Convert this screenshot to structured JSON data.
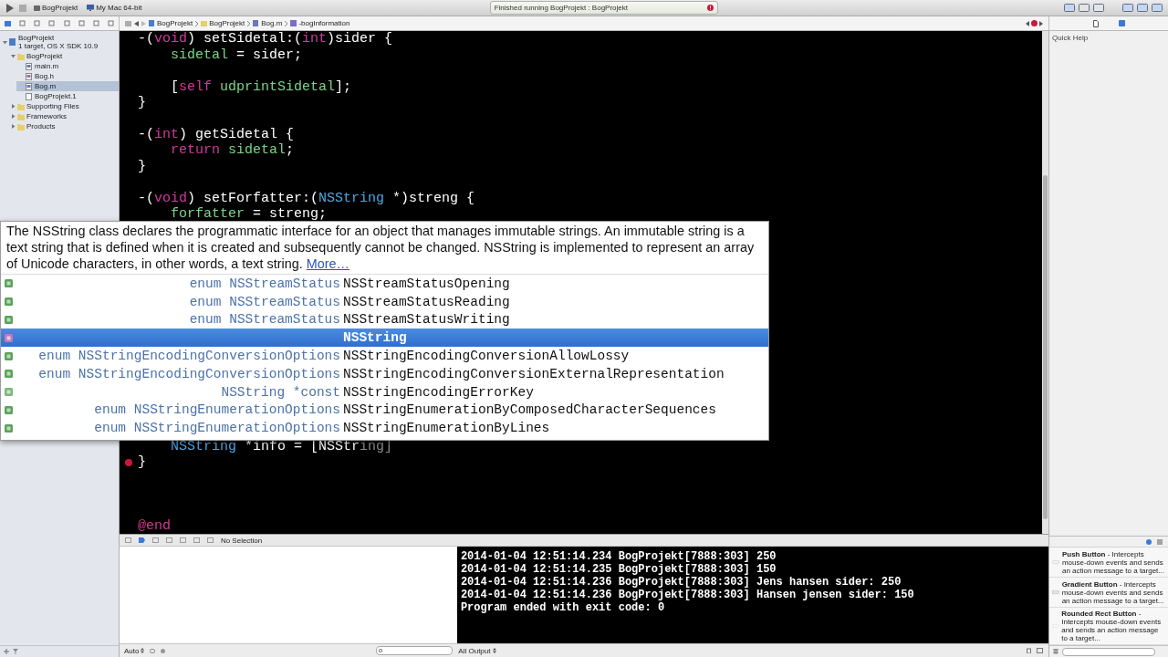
{
  "toolbar": {
    "scheme": "BogProjekt",
    "destination": "My Mac 64-bit",
    "status": "Finished running BogProjekt : BogProjekt"
  },
  "jump_bar": [
    "BogProjekt",
    "BogProjekt",
    "Bog.m",
    "-bogInformation"
  ],
  "navigator": {
    "tree": [
      {
        "label": "BogProjekt",
        "subtitle": "1 target, OS X SDK 10.9",
        "kind": "project",
        "expanded": true,
        "selected": false,
        "children": [
          {
            "label": "BogProjekt",
            "kind": "folder",
            "expanded": true,
            "selected": false,
            "children": [
              {
                "label": "main.m",
                "kind": "source",
                "selected": false
              },
              {
                "label": "Bog.h",
                "kind": "header",
                "selected": false
              },
              {
                "label": "Bog.m",
                "kind": "source",
                "selected": true
              },
              {
                "label": "BogProjekt.1",
                "kind": "doc",
                "selected": false
              }
            ]
          },
          {
            "label": "Supporting Files",
            "kind": "folder",
            "expanded": false,
            "selected": false
          },
          {
            "label": "Frameworks",
            "kind": "folder",
            "expanded": false,
            "selected": false
          },
          {
            "label": "Products",
            "kind": "folder",
            "expanded": false,
            "selected": false
          }
        ]
      }
    ]
  },
  "editor": {
    "top_lines": [
      {
        "kind": "code",
        "indented": false,
        "tokens": [
          {
            "text": "-(",
            "kind": "plain"
          },
          {
            "text": "void",
            "kind": "keyword"
          },
          {
            "text": ") setSidetal:(",
            "kind": "plain"
          },
          {
            "text": "int",
            "kind": "keyword"
          },
          {
            "text": ")sider {",
            "kind": "plain"
          }
        ]
      },
      {
        "kind": "code",
        "indented": true,
        "tokens": [
          {
            "text": "sidetal",
            "kind": "ivar"
          },
          {
            "text": " = sider;",
            "kind": "plain"
          }
        ]
      },
      {
        "kind": "blank"
      },
      {
        "kind": "code",
        "indented": true,
        "tokens": [
          {
            "text": "[",
            "kind": "plain"
          },
          {
            "text": "self ",
            "kind": "keyword"
          },
          {
            "text": "udprintSidetal",
            "kind": "ivar"
          },
          {
            "text": "];",
            "kind": "plain"
          }
        ]
      },
      {
        "kind": "code",
        "indented": false,
        "tokens": [
          {
            "text": "}",
            "kind": "plain"
          }
        ]
      },
      {
        "kind": "blank"
      },
      {
        "kind": "code",
        "indented": false,
        "tokens": [
          {
            "text": "-(",
            "kind": "plain"
          },
          {
            "text": "int",
            "kind": "keyword"
          },
          {
            "text": ") getSidetal {",
            "kind": "plain"
          }
        ]
      },
      {
        "kind": "code",
        "indented": true,
        "tokens": [
          {
            "text": "return ",
            "kind": "keyword"
          },
          {
            "text": "sidetal",
            "kind": "ivar"
          },
          {
            "text": ";",
            "kind": "plain"
          }
        ]
      },
      {
        "kind": "code",
        "indented": false,
        "tokens": [
          {
            "text": "}",
            "kind": "plain"
          }
        ]
      },
      {
        "kind": "blank"
      },
      {
        "kind": "code",
        "indented": false,
        "tokens": [
          {
            "text": "-(",
            "kind": "plain"
          },
          {
            "text": "void",
            "kind": "keyword"
          },
          {
            "text": ") setForfatter:(",
            "kind": "plain"
          },
          {
            "text": "NSString",
            "kind": "type"
          },
          {
            "text": " *)streng {",
            "kind": "plain"
          }
        ]
      },
      {
        "kind": "code",
        "indented": true,
        "tokens": [
          {
            "text": "forfatter",
            "kind": "ivar"
          },
          {
            "text": " = streng;",
            "kind": "plain"
          }
        ]
      }
    ],
    "bottom_lines": [
      {
        "kind": "code",
        "indented": true,
        "tokens": [
          {
            "text": "NSString",
            "kind": "type"
          },
          {
            "text": " *info = [NSStr",
            "kind": "plain"
          },
          {
            "text": "ing]",
            "kind": "placeholder"
          }
        ]
      },
      {
        "kind": "code",
        "indented": false,
        "issue": true,
        "tokens": [
          {
            "text": "}",
            "kind": "plain"
          }
        ]
      },
      {
        "kind": "blank"
      },
      {
        "kind": "blank"
      },
      {
        "kind": "blank"
      },
      {
        "kind": "code",
        "indented": false,
        "tokens": [
          {
            "text": "@end",
            "kind": "directive"
          }
        ]
      }
    ]
  },
  "completion": {
    "description": "The NSString class declares the programmatic interface for an object that manages immutable strings. An immutable string is a text string that is defined when it is created and subsequently cannot be changed. NSString is implemented to represent an array of Unicode characters, in other words, a text string.",
    "more_link": "More…",
    "rows": [
      {
        "kind": "enum",
        "type": "enum NSStreamStatus",
        "name": "NSStreamStatusOpening",
        "selected": false
      },
      {
        "kind": "enum",
        "type": "enum NSStreamStatus",
        "name": "NSStreamStatusReading",
        "selected": false
      },
      {
        "kind": "enum",
        "type": "enum NSStreamStatus",
        "name": "NSStreamStatusWriting",
        "selected": false
      },
      {
        "kind": "class",
        "name": "NSString",
        "selected": true
      },
      {
        "kind": "enum",
        "type": "enum NSStringEncodingConversionOptions",
        "name": "NSStringEncodingConversionAllowLossy",
        "selected": false
      },
      {
        "kind": "enum",
        "type": "enum NSStringEncodingConversionOptions",
        "name": "NSStringEncodingConversionExternalRepresentation",
        "selected": false
      },
      {
        "kind": "constant",
        "type": "NSString *const",
        "name": "NSStringEncodingErrorKey",
        "selected": false
      },
      {
        "kind": "enum",
        "type": "enum NSStringEnumerationOptions",
        "name": "NSStringEnumerationByComposedCharacterSequences",
        "selected": false
      },
      {
        "kind": "enum",
        "type": "enum NSStringEnumerationOptions",
        "name": "NSStringEnumerationByLines",
        "selected": false
      }
    ]
  },
  "debug": {
    "selection": "No Selection",
    "scope": "Auto",
    "output": "All Output",
    "console": [
      "2014-01-04 12:51:14.234 BogProjekt[7888:303] 250",
      "2014-01-04 12:51:14.235 BogProjekt[7888:303] 150",
      "2014-01-04 12:51:14.236 BogProjekt[7888:303] Jens hansen sider: 250",
      "2014-01-04 12:51:14.236 BogProjekt[7888:303] Hansen jensen sider: 150",
      "Program ended with exit code: 0"
    ]
  },
  "utilities": {
    "title": "Quick Help",
    "library": [
      {
        "kind": "push",
        "text": "**Push Button** - Intercepts mouse-down events and sends an action message to a target..."
      },
      {
        "kind": "gradient",
        "text": "**Gradient Button** - Intercepts mouse-down events and sends an action message to a target..."
      },
      {
        "kind": "rounded",
        "text": "**Rounded Rect Button** - Intercepts mouse-down events and sends an action message to a target..."
      }
    ]
  }
}
